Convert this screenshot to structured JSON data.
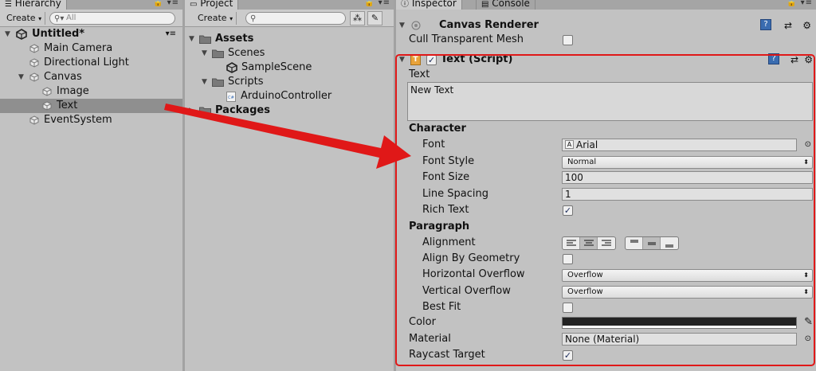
{
  "hierarchy": {
    "tab": "Hierarchy",
    "create": "Create",
    "search_placeholder": "All",
    "scene": "Untitled*",
    "items": [
      {
        "label": "Main Camera"
      },
      {
        "label": "Directional Light"
      },
      {
        "label": "Canvas"
      },
      {
        "label": "Image"
      },
      {
        "label": "Text"
      },
      {
        "label": "EventSystem"
      }
    ]
  },
  "project": {
    "tab": "Project",
    "create": "Create",
    "tree": {
      "assets": "Assets",
      "scenes": "Scenes",
      "sample_scene": "SampleScene",
      "scripts": "Scripts",
      "arduino": "ArduinoController",
      "packages": "Packages"
    }
  },
  "inspector": {
    "tabs": [
      "Inspector",
      "Console"
    ],
    "canvas_renderer": {
      "title": "Canvas Renderer",
      "cull_label": "Cull Transparent Mesh",
      "cull_checked": false
    },
    "text_script": {
      "title": "Text (Script)",
      "enabled": true,
      "text_label": "Text",
      "text_value": "New Text",
      "character_header": "Character",
      "font_label": "Font",
      "font_value": "Arial",
      "font_style_label": "Font Style",
      "font_style_value": "Normal",
      "font_size_label": "Font Size",
      "font_size_value": "100",
      "line_spacing_label": "Line Spacing",
      "line_spacing_value": "1",
      "rich_text_label": "Rich Text",
      "rich_text_checked": true,
      "paragraph_header": "Paragraph",
      "alignment_label": "Alignment",
      "align_geom_label": "Align By Geometry",
      "align_geom_checked": false,
      "h_overflow_label": "Horizontal Overflow",
      "h_overflow_value": "Overflow",
      "v_overflow_label": "Vertical Overflow",
      "v_overflow_value": "Overflow",
      "best_fit_label": "Best Fit",
      "best_fit_checked": false,
      "color_label": "Color",
      "color_value": "#222222",
      "material_label": "Material",
      "material_value": "None (Material)",
      "raycast_label": "Raycast Target",
      "raycast_checked": true
    }
  },
  "colors": {
    "annotation_red": "#e01818",
    "selection": "#8f8f8f",
    "panel_bg": "#c2c2c2"
  }
}
